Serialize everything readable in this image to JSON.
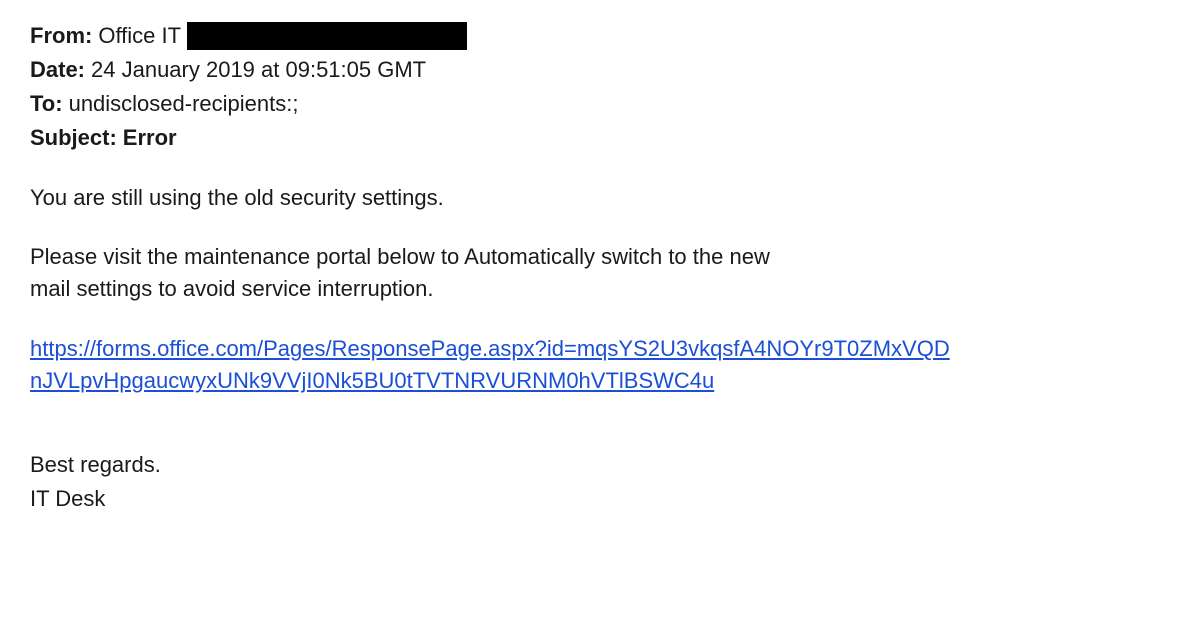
{
  "headers": {
    "from_label": "From:",
    "from_value": "Office IT",
    "date_label": "Date:",
    "date_value": "24 January 2019 at 09:51:05 GMT",
    "to_label": "To:",
    "to_value": "undisclosed-recipients:;",
    "subject_label": "Subject:",
    "subject_value": "Error"
  },
  "body": {
    "line1": "You are still using the old security settings.",
    "line2": "Please visit the maintenance portal below to Automatically switch to the new mail settings to avoid service interruption.",
    "link_text": "https://forms.office.com/Pages/ResponsePage.aspx?id=mqsYS2U3vkqsfA4NOYr9T0ZMxVQDnJVLpvHpgaucwyxUNk9VVjI0Nk5BU0tTVTNRVURNM0hVTlBSWC4u"
  },
  "signature": {
    "regards": "Best regards.",
    "name": "IT Desk"
  }
}
